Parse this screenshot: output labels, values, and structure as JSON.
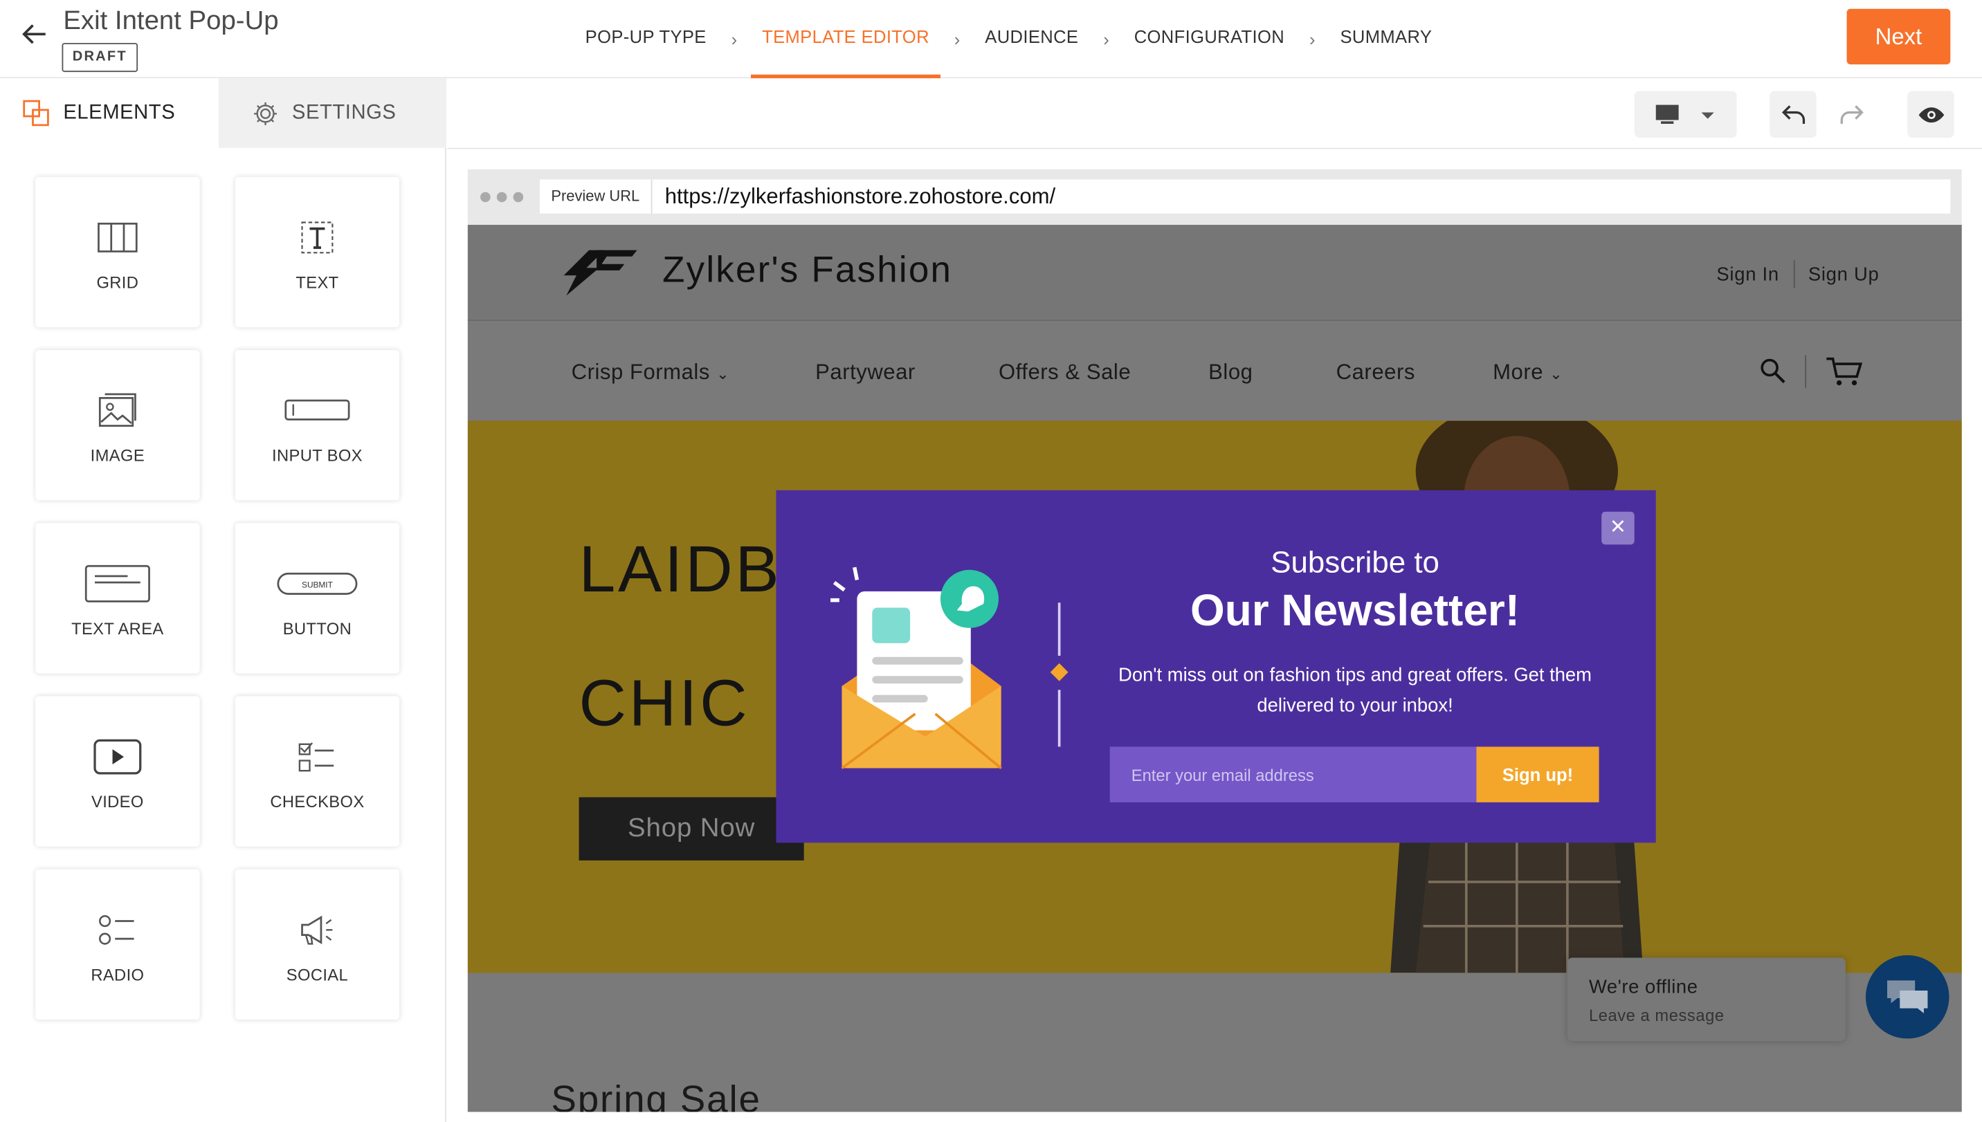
{
  "header": {
    "title": "Exit Intent Pop-Up",
    "badge": "DRAFT",
    "next_label": "Next",
    "steps": [
      {
        "label": "POP-UP TYPE",
        "active": false
      },
      {
        "label": "TEMPLATE EDITOR",
        "active": true
      },
      {
        "label": "AUDIENCE",
        "active": false
      },
      {
        "label": "CONFIGURATION",
        "active": false
      },
      {
        "label": "SUMMARY",
        "active": false
      }
    ],
    "accent": "#f7712b"
  },
  "left_panel": {
    "tabs": {
      "elements": "ELEMENTS",
      "settings": "SETTINGS"
    },
    "elements": [
      {
        "label": "GRID",
        "icon": "grid-icon"
      },
      {
        "label": "TEXT",
        "icon": "text-icon"
      },
      {
        "label": "IMAGE",
        "icon": "image-icon"
      },
      {
        "label": "INPUT BOX",
        "icon": "input-box-icon"
      },
      {
        "label": "TEXT AREA",
        "icon": "text-area-icon"
      },
      {
        "label": "BUTTON",
        "icon": "button-icon",
        "icon_text": "SUBMIT"
      },
      {
        "label": "VIDEO",
        "icon": "video-icon"
      },
      {
        "label": "CHECKBOX",
        "icon": "checkbox-icon"
      },
      {
        "label": "RADIO",
        "icon": "radio-icon"
      },
      {
        "label": "SOCIAL",
        "icon": "megaphone-icon"
      }
    ]
  },
  "toolbar": {
    "device": "desktop-icon",
    "undo": "undo-icon",
    "redo": "redo-icon",
    "preview": "eye-icon"
  },
  "preview": {
    "url_tag": "Preview URL",
    "url": "https://zylkerfashionstore.zohostore.com/"
  },
  "site": {
    "brand": "Zylker's Fashion",
    "sign_in": "Sign In",
    "sign_up": "Sign Up",
    "nav": [
      "Crisp Formals",
      "Partywear",
      "Offers & Sale",
      "Blog",
      "Careers",
      "More"
    ],
    "hero_line1": "LAIDB",
    "hero_line2": "CHIC",
    "cta": "Shop Now",
    "section_title": "Spring Sale",
    "chat_title": "We're offline",
    "chat_sub": "Leave a message"
  },
  "popup": {
    "line1": "Subscribe to",
    "line2": "Our Newsletter!",
    "body": "Don't miss out on fashion tips and great offers. Get them delivered to your inbox!",
    "email_placeholder": "Enter your email address",
    "button": "Sign up!",
    "bg_color": "#4b2e9e",
    "button_color": "#f4a62a"
  }
}
